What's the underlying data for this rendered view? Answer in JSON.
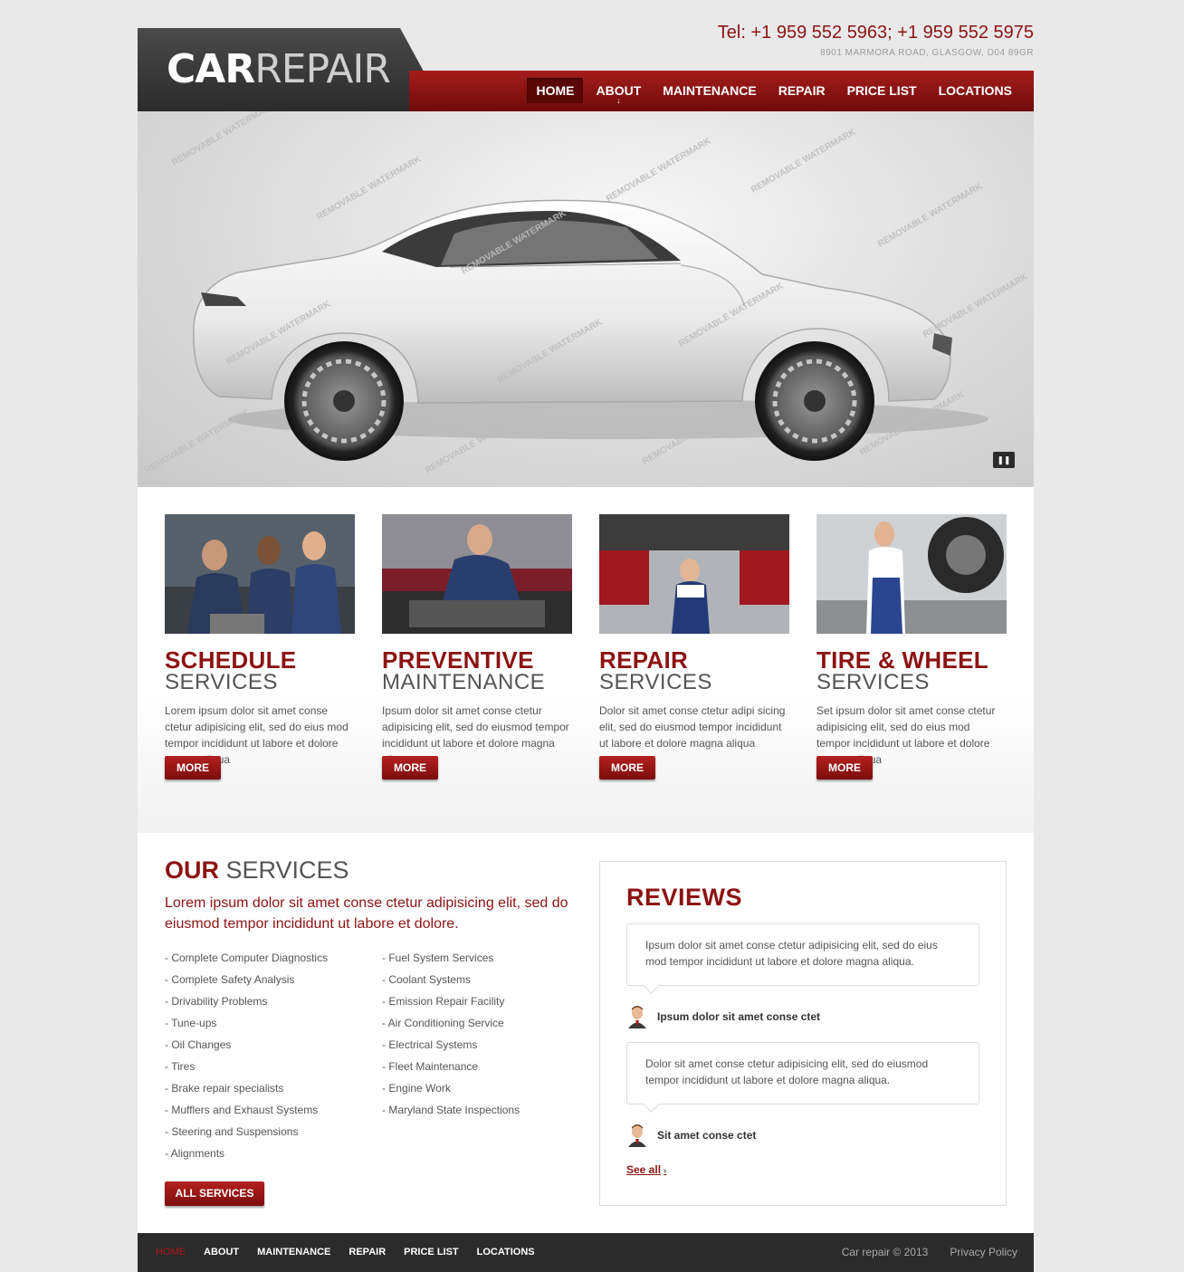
{
  "header": {
    "logo_bold": "CAR",
    "logo_light": "REPAIR",
    "phone": "Tel: +1 959 552 5963;   +1 959 552 5975",
    "address": "8901 MARMORA ROAD, GLASGOW, D04 89GR"
  },
  "nav": {
    "items": [
      "HOME",
      "ABOUT",
      "MAINTENANCE",
      "REPAIR",
      "PRICE LIST",
      "LOCATIONS"
    ],
    "active": "HOME"
  },
  "hero": {
    "watermark": "REMOVABLE WATERMARK",
    "pause_icon": "pause-icon"
  },
  "features": [
    {
      "title": "SCHEDULE",
      "subtitle": "SERVICES",
      "text": "Lorem ipsum dolor sit amet conse ctetur adipisicing elit, sed do eius mod tempor incididunt ut labore et dolore magna aliqua",
      "button": "MORE"
    },
    {
      "title": "PREVENTIVE",
      "subtitle": "MAINTENANCE",
      "text": "Ipsum dolor sit amet conse ctetur adipisicing elit, sed do eiusmod tempor incididunt ut labore et dolore magna aliqua",
      "button": "MORE"
    },
    {
      "title": "REPAIR",
      "subtitle": "SERVICES",
      "text": "Dolor sit amet conse ctetur adipi sicing elit, sed do eiusmod tempor incididunt ut labore et dolore magna aliqua",
      "button": "MORE"
    },
    {
      "title": "TIRE & WHEEL",
      "subtitle": "SERVICES",
      "text": "Set ipsum dolor sit amet conse ctetur adipisicing elit, sed do eius mod tempor incididunt ut labore et dolore magna aliqua",
      "button": "MORE"
    }
  ],
  "our_services": {
    "title_bold": "OUR",
    "title_light": " SERVICES",
    "intro": "Lorem ipsum dolor sit amet conse ctetur adipisicing elit, sed do eiusmod tempor incididunt ut labore et dolore.",
    "list_left": [
      "Complete Computer Diagnostics",
      "Complete Safety Analysis",
      "Drivability Problems",
      "Tune-ups",
      "Oil Changes",
      "Tires",
      "Brake repair specialists",
      "Mufflers and Exhaust Systems",
      "Steering and Suspensions",
      "Alignments"
    ],
    "list_right": [
      "Fuel System Services",
      "Coolant Systems",
      "Emission Repair Facility",
      "Air Conditioning Service",
      "Electrical Systems",
      "Fleet Maintenance",
      "Engine Work",
      "Maryland State Inspections"
    ],
    "button": "ALL SERVICES"
  },
  "reviews": {
    "title": "REVIEWS",
    "items": [
      {
        "text": "Ipsum dolor sit amet conse ctetur adipisicing elit, sed do eius mod tempor incididunt ut labore et dolore magna aliqua.",
        "author": "Ipsum dolor sit amet conse ctet"
      },
      {
        "text": "Dolor sit amet conse ctetur adipisicing elit, sed do eiusmod tempor incididunt ut labore et dolore magna aliqua.",
        "author": "Sit amet conse ctet"
      }
    ],
    "see_all": "See all",
    "see_all_arrow": "›"
  },
  "footer": {
    "nav": [
      "HOME",
      "ABOUT",
      "MAINTENANCE",
      "REPAIR",
      "PRICE LIST",
      "LOCATIONS"
    ],
    "copyright": "Car repair © 2013",
    "privacy": "Privacy Policy"
  },
  "colors": {
    "brand_red": "#8c1313",
    "nav_gradient_top": "#a51d1d",
    "nav_gradient_bottom": "#6f0a0a",
    "dark": "#2b2b2b"
  }
}
